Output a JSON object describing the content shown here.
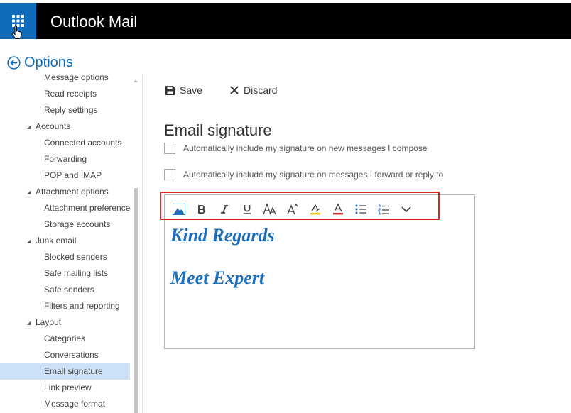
{
  "app": {
    "title": "Outlook Mail",
    "accent": "#0f6cbd"
  },
  "options": {
    "title": "Options"
  },
  "sidebar": {
    "items": [
      {
        "label": "Message options",
        "kind": "sub"
      },
      {
        "label": "Read receipts",
        "kind": "sub"
      },
      {
        "label": "Reply settings",
        "kind": "sub"
      },
      {
        "label": "Accounts",
        "kind": "group"
      },
      {
        "label": "Connected accounts",
        "kind": "sub"
      },
      {
        "label": "Forwarding",
        "kind": "sub"
      },
      {
        "label": "POP and IMAP",
        "kind": "sub"
      },
      {
        "label": "Attachment options",
        "kind": "group"
      },
      {
        "label": "Attachment preference",
        "kind": "sub"
      },
      {
        "label": "Storage accounts",
        "kind": "sub"
      },
      {
        "label": "Junk email",
        "kind": "group"
      },
      {
        "label": "Blocked senders",
        "kind": "sub"
      },
      {
        "label": "Safe mailing lists",
        "kind": "sub"
      },
      {
        "label": "Safe senders",
        "kind": "sub"
      },
      {
        "label": "Filters and reporting",
        "kind": "sub"
      },
      {
        "label": "Layout",
        "kind": "group"
      },
      {
        "label": "Categories",
        "kind": "sub"
      },
      {
        "label": "Conversations",
        "kind": "sub"
      },
      {
        "label": "Email signature",
        "kind": "sub",
        "selected": true
      },
      {
        "label": "Link preview",
        "kind": "sub"
      },
      {
        "label": "Message format",
        "kind": "sub"
      }
    ]
  },
  "toolbar": {
    "save_label": "Save",
    "discard_label": "Discard"
  },
  "main": {
    "heading": "Email signature",
    "checkbox_new": {
      "label": "Automatically include my signature on new messages I compose",
      "checked": false
    },
    "checkbox_reply": {
      "label": "Automatically include my signature on messages I forward or reply to",
      "checked": false
    }
  },
  "editor": {
    "format_buttons": [
      "insert-picture-icon",
      "bold-icon",
      "italic-icon",
      "underline-icon",
      "font-size-icon",
      "grow-font-icon",
      "highlight-icon",
      "font-color-icon",
      "bullets-icon",
      "numbering-icon",
      "more-options-icon"
    ],
    "signature_lines": [
      "Kind Regards",
      "Meet Expert"
    ],
    "signature_color": "#1c6fbf",
    "highlight_color": "#d9282a"
  }
}
